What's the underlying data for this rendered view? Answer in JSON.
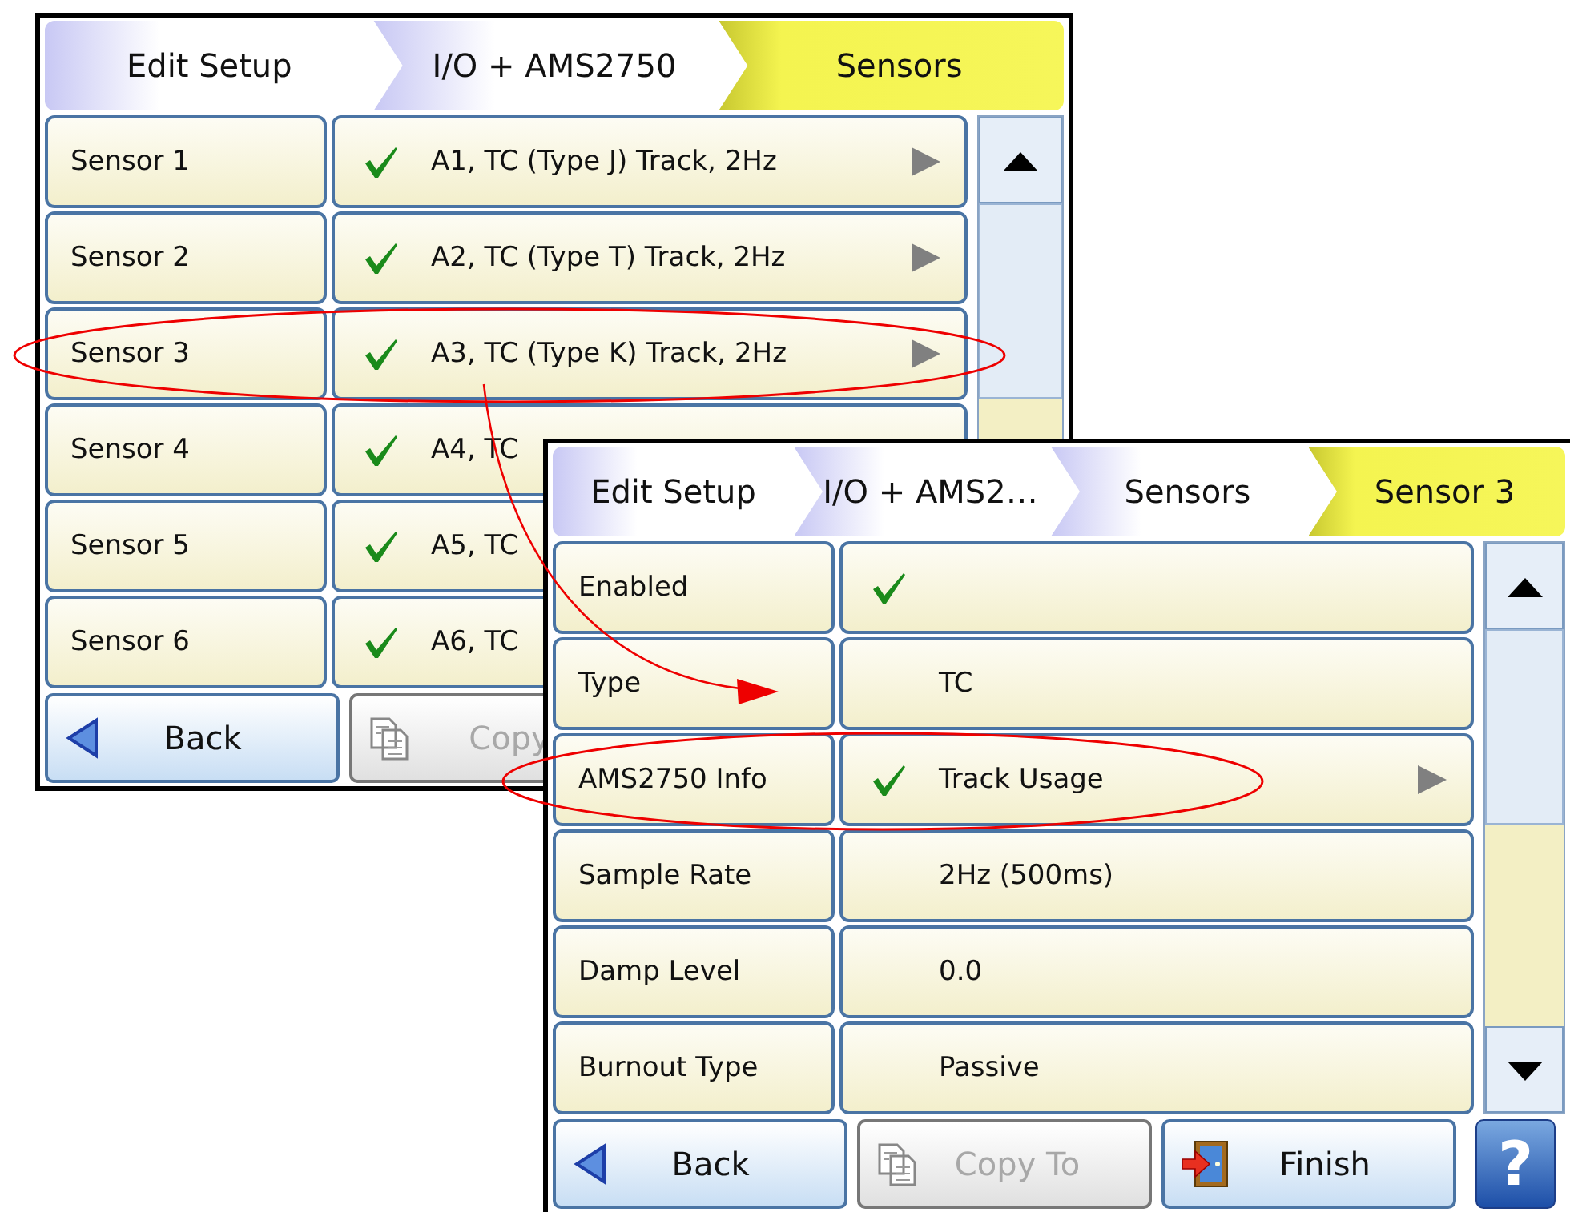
{
  "screens": [
    {
      "breadcrumb": [
        {
          "label": "Edit Setup",
          "selected": false
        },
        {
          "label": "I/O + AMS2750",
          "selected": false
        },
        {
          "label": "Sensors",
          "selected": true
        }
      ],
      "rows": [
        {
          "label": "Sensor 1",
          "checked": true,
          "value": "A1, TC (Type J) Track, 2Hz",
          "submenu": true
        },
        {
          "label": "Sensor 2",
          "checked": true,
          "value": "A2, TC (Type T) Track, 2Hz",
          "submenu": true
        },
        {
          "label": "Sensor 3",
          "checked": true,
          "value": "A3, TC (Type K) Track, 2Hz",
          "submenu": true
        },
        {
          "label": "Sensor 4",
          "checked": true,
          "value": "A4, TC",
          "submenu": false
        },
        {
          "label": "Sensor 5",
          "checked": true,
          "value": "A5, TC",
          "submenu": false
        },
        {
          "label": "Sensor 6",
          "checked": true,
          "value": "A6, TC",
          "submenu": false
        }
      ],
      "buttons": [
        {
          "kind": "back",
          "label": "Back",
          "disabled": false
        },
        {
          "kind": "copy",
          "label": "Copy",
          "disabled": true
        }
      ]
    },
    {
      "breadcrumb": [
        {
          "label": "Edit Setup",
          "selected": false
        },
        {
          "label": "I/O + AMS2…",
          "selected": false
        },
        {
          "label": "Sensors",
          "selected": false
        },
        {
          "label": "Sensor 3",
          "selected": true
        }
      ],
      "rows": [
        {
          "label": "Enabled",
          "checked": true,
          "submenu": false
        },
        {
          "label": "Type",
          "checked": false,
          "value": "TC",
          "submenu": false
        },
        {
          "label": "AMS2750 Info",
          "checked": true,
          "value": "Track Usage",
          "submenu": true
        },
        {
          "label": "Sample Rate",
          "checked": false,
          "value": "2Hz (500ms)",
          "submenu": false
        },
        {
          "label": "Damp Level",
          "checked": false,
          "value": "0.0",
          "submenu": false
        },
        {
          "label": "Burnout Type",
          "checked": false,
          "value": "Passive",
          "submenu": false
        }
      ],
      "scroll_down": true,
      "buttons": [
        {
          "kind": "back",
          "label": "Back",
          "disabled": false
        },
        {
          "kind": "copy",
          "label": "Copy To",
          "disabled": true
        },
        {
          "kind": "finish",
          "label": "Finish",
          "disabled": false
        },
        {
          "kind": "help",
          "label": "?",
          "disabled": false
        }
      ]
    }
  ],
  "annotations": [
    {
      "kind": "ellipse"
    },
    {
      "kind": "ellipse"
    },
    {
      "kind": "arrow"
    }
  ]
}
